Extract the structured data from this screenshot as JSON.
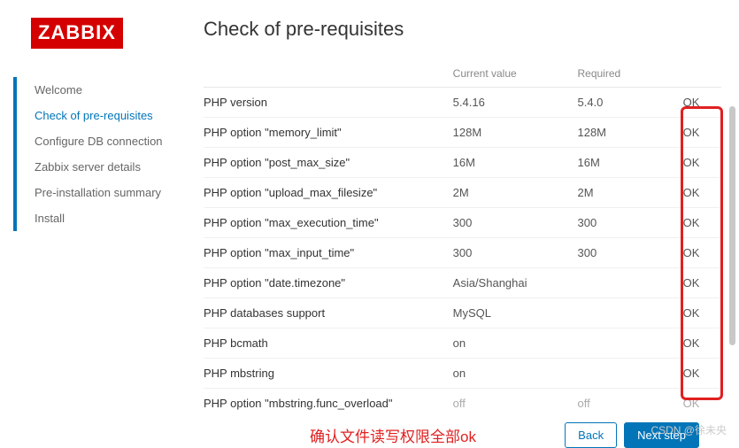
{
  "logo": "ZABBIX",
  "title": "Check of pre-requisites",
  "steps": [
    {
      "label": "Welcome",
      "active": false
    },
    {
      "label": "Check of pre-requisites",
      "active": true
    },
    {
      "label": "Configure DB connection",
      "active": false
    },
    {
      "label": "Zabbix server details",
      "active": false
    },
    {
      "label": "Pre-installation summary",
      "active": false
    },
    {
      "label": "Install",
      "active": false
    }
  ],
  "columns": {
    "name": "",
    "current": "Current value",
    "required": "Required",
    "status": ""
  },
  "rows": [
    {
      "name": "PHP version",
      "current": "5.4.16",
      "required": "5.4.0",
      "status": "OK"
    },
    {
      "name": "PHP option \"memory_limit\"",
      "current": "128M",
      "required": "128M",
      "status": "OK"
    },
    {
      "name": "PHP option \"post_max_size\"",
      "current": "16M",
      "required": "16M",
      "status": "OK"
    },
    {
      "name": "PHP option \"upload_max_filesize\"",
      "current": "2M",
      "required": "2M",
      "status": "OK"
    },
    {
      "name": "PHP option \"max_execution_time\"",
      "current": "300",
      "required": "300",
      "status": "OK"
    },
    {
      "name": "PHP option \"max_input_time\"",
      "current": "300",
      "required": "300",
      "status": "OK"
    },
    {
      "name": "PHP option \"date.timezone\"",
      "current": "Asia/Shanghai",
      "required": "",
      "status": "OK"
    },
    {
      "name": "PHP databases support",
      "current": "MySQL",
      "required": "",
      "status": "OK"
    },
    {
      "name": "PHP bcmath",
      "current": "on",
      "required": "",
      "status": "OK"
    },
    {
      "name": "PHP mbstring",
      "current": "on",
      "required": "",
      "status": "OK"
    }
  ],
  "partial_row": {
    "name": "PHP option \"mbstring.func_overload\"",
    "current": "off",
    "required": "off",
    "status": "OK"
  },
  "annotation": "确认文件读写权限全部ok",
  "buttons": {
    "back": "Back",
    "next": "Next step"
  },
  "watermark": "CSDN @徐未央"
}
